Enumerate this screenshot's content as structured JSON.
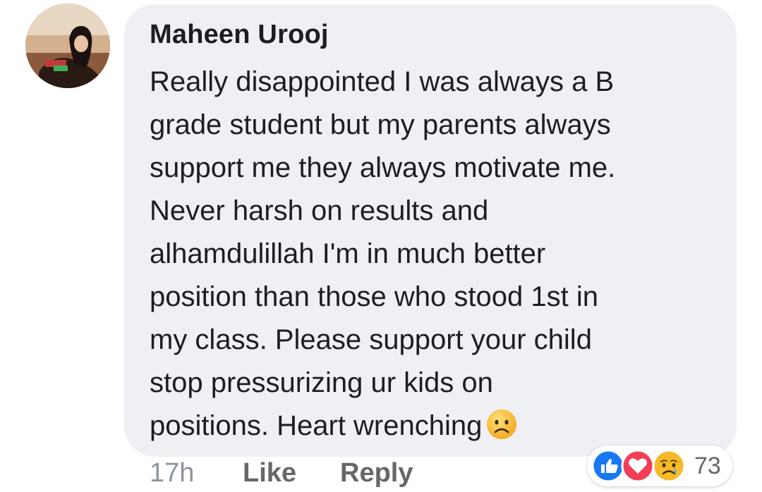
{
  "comment": {
    "author": "Maheen Urooj",
    "lines": [
      "Really disappointed I was always a B",
      "grade student but my parents always",
      "support me they always motivate me.",
      "Never harsh on results and",
      "alhamdulillah I'm in much better",
      "position than those who stood 1st in",
      "my class. Please support your child",
      "stop pressurizing ur kids on",
      "positions. Heart wrenching"
    ],
    "trailing_emoji": "sad-face-emoji"
  },
  "actions": {
    "time": "17h",
    "like_label": "Like",
    "reply_label": "Reply"
  },
  "reactions": {
    "icons": [
      "like-reaction-icon",
      "love-reaction-icon",
      "sad-reaction-icon"
    ],
    "count": "73",
    "colors": {
      "like": "#1877f2",
      "love": "#f33e58",
      "sad": "#f7b928"
    }
  },
  "colors": {
    "bubble": "#eff0f4",
    "text": "#1c1e21",
    "meta": "#65676b"
  }
}
